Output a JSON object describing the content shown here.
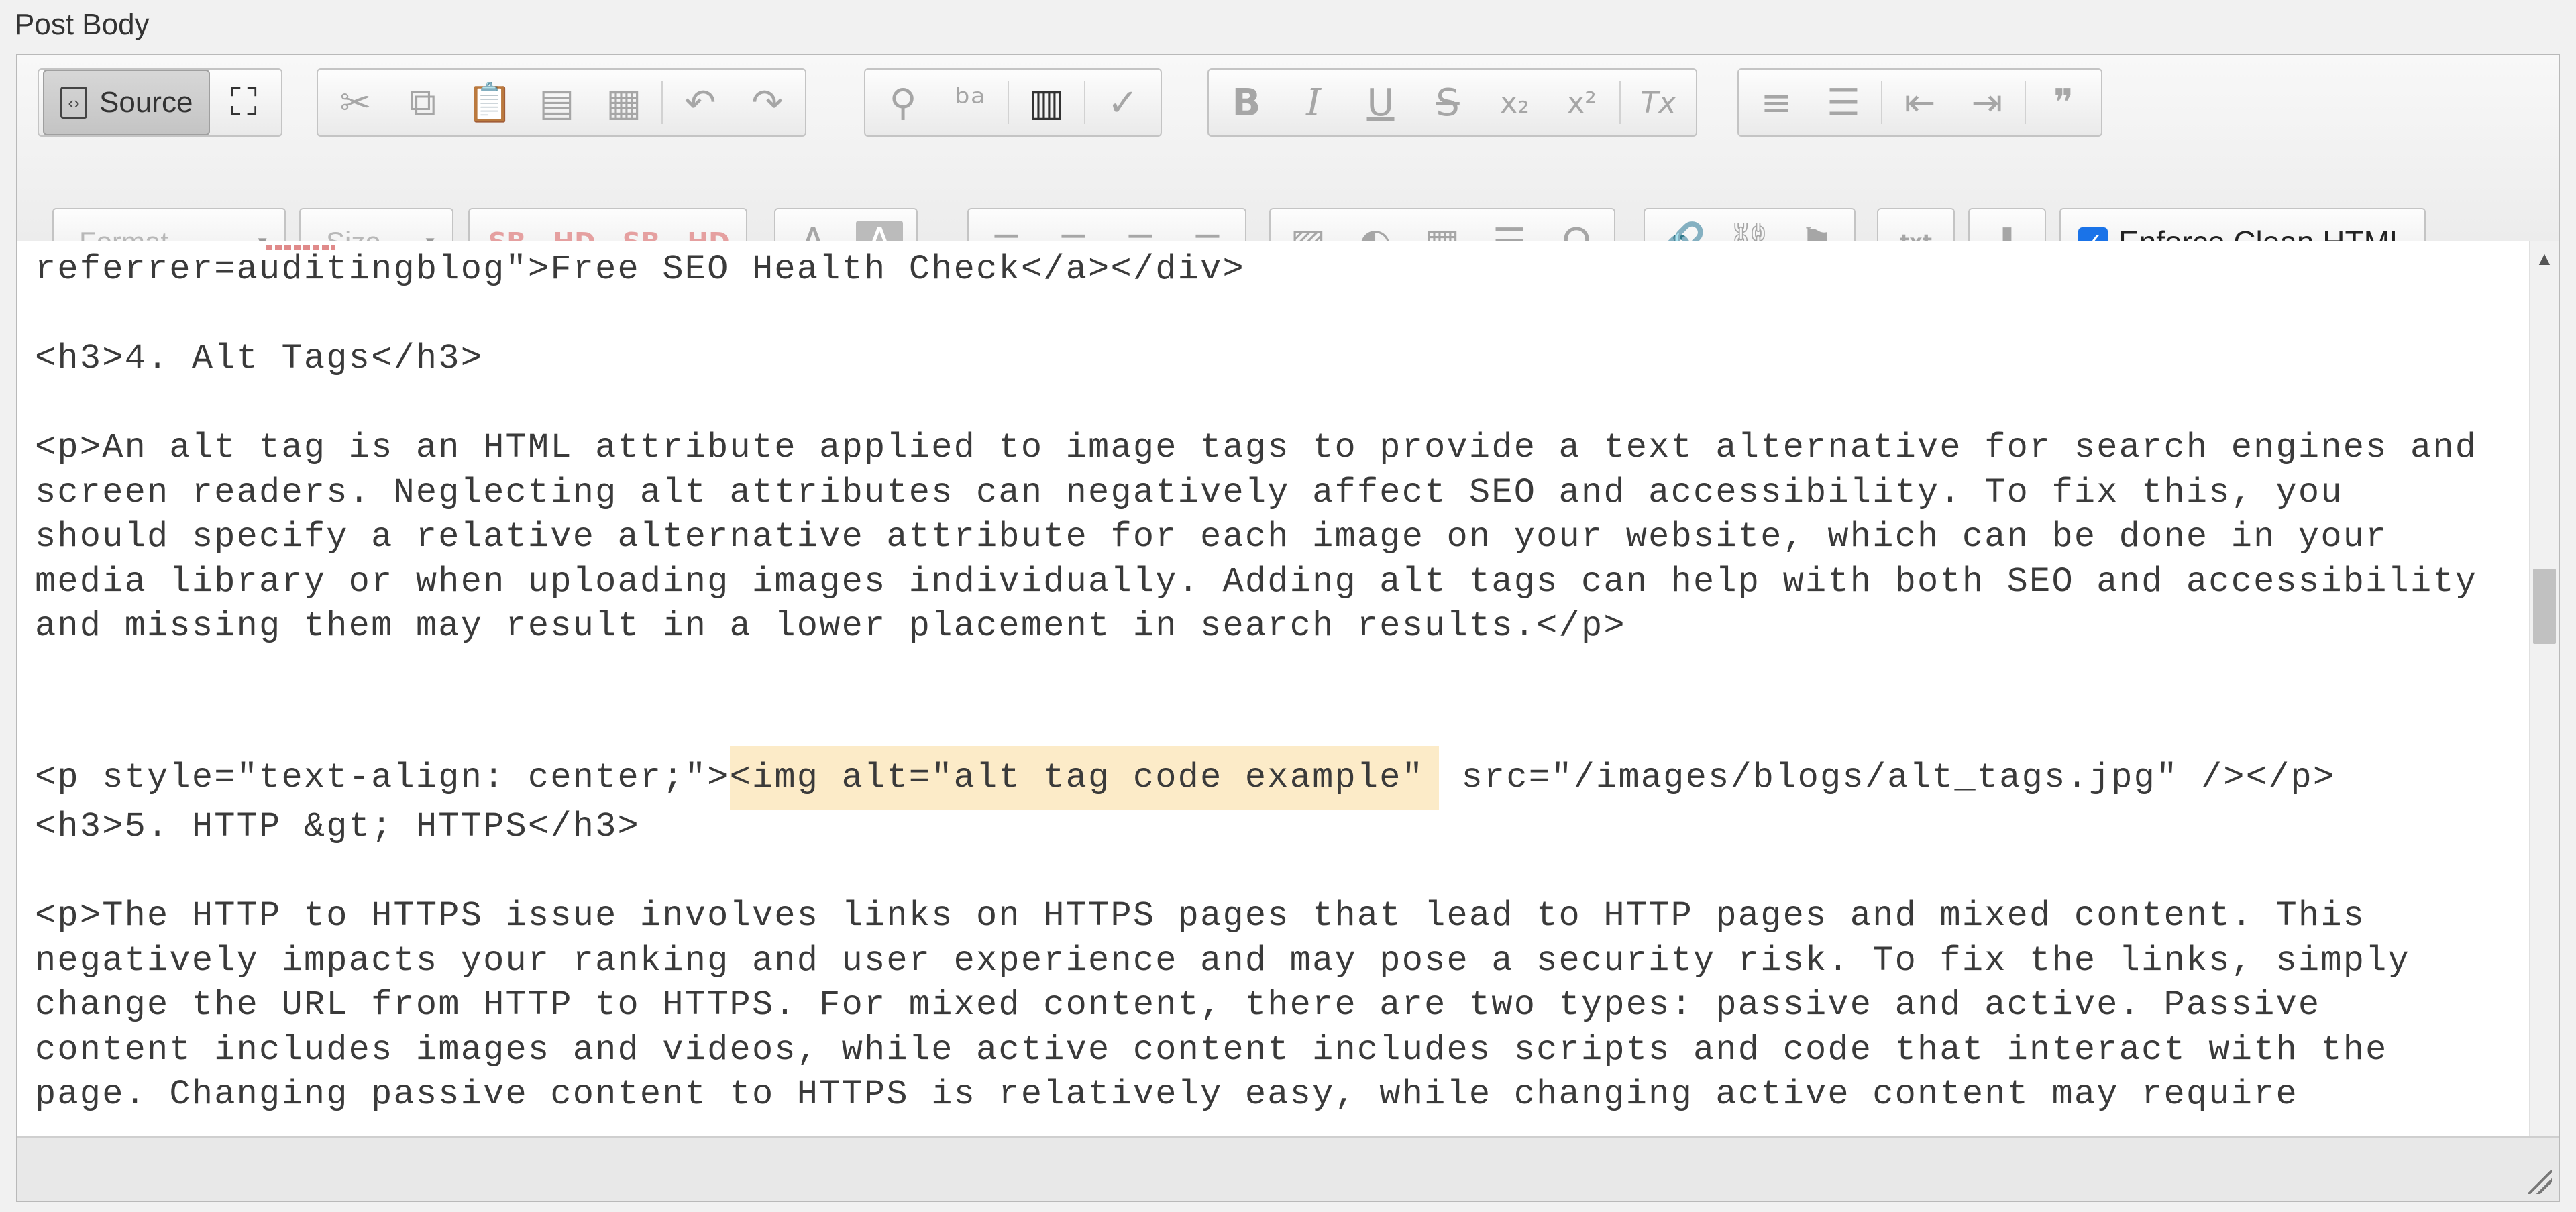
{
  "field_label": "Post Body",
  "toolbar": {
    "source_label": "Source",
    "format_label": "Format",
    "size_label": "Size",
    "enforce_label": "Enforce Clean HTML",
    "icons": {
      "maximize": "⛶",
      "cut": "✂",
      "copy": "⧉",
      "paste": "📋",
      "paste_text": "▤",
      "paste_word": "▦",
      "undo": "↶",
      "redo": "↷",
      "find": "⚲",
      "replace": "ᵇᵃ",
      "select_all": "▥",
      "spellcheck": "✓",
      "bold": "B",
      "italic": "I",
      "underline": "U",
      "strike": "S",
      "subscript": "x₂",
      "superscript": "x²",
      "remove_format": "Tx",
      "numbered_list": "≡",
      "bulleted_list": "☰",
      "outdent": "⇤",
      "indent": "⇥",
      "blockquote": "❞",
      "sb": "SB",
      "hd": "HD",
      "sb_remove": "SB",
      "hd_remove": "HD",
      "text_color": "A",
      "bg_color": "A",
      "align_left": "≡",
      "align_center": "≡",
      "align_right": "≡",
      "justify": "≡",
      "image": "▨",
      "flash": "◐",
      "table": "▦",
      "hr": "☰",
      "omega": "Ω",
      "link": "🔗",
      "unlink": "⛓",
      "anchor": "⚑",
      "txt_img": "txt",
      "download": "⬇"
    }
  },
  "content": {
    "lines": [
      "referrer=auditingblog\">Free SEO Health Check</a></div>",
      "",
      "<h3>4. Alt Tags</h3>",
      "",
      "<p>An alt tag is an HTML attribute applied to image tags to provide a text alternative for search engines and",
      "screen readers. Neglecting alt attributes can negatively affect SEO and accessibility. To fix this, you",
      "should specify a relative alternative attribute for each image on your website, which can be done in your",
      "media library or when uploading images individually. Adding alt tags can help with both SEO and accessibility",
      "and missing them may result in a lower placement in search results.</p>",
      "",
      "",
      "",
      "<h3>5. HTTP &gt; HTTPS</h3>",
      "",
      "<p>The HTTP to HTTPS issue involves links on HTTPS pages that lead to HTTP pages and mixed content. This",
      "negatively impacts your ranking and user experience and may pose a security risk. To fix the links, simply",
      "change the URL from HTTP to HTTPS. For mixed content, there are two types: passive and active. Passive",
      "content includes images and videos, while active content includes scripts and code that interact with the",
      "page. Changing passive content to HTTPS is relatively easy, while changing active content may require"
    ],
    "img_line": {
      "before": "<p style=\"text-align: center;\">",
      "highlight": "<img alt=\"alt tag code example\"",
      "after": " src=\"/images/blogs/alt_tags.jpg\" /></p>"
    }
  },
  "colors": {
    "highlight": "#fcebc8",
    "checkbox": "#1a73e8",
    "dot": "#c8102e"
  }
}
